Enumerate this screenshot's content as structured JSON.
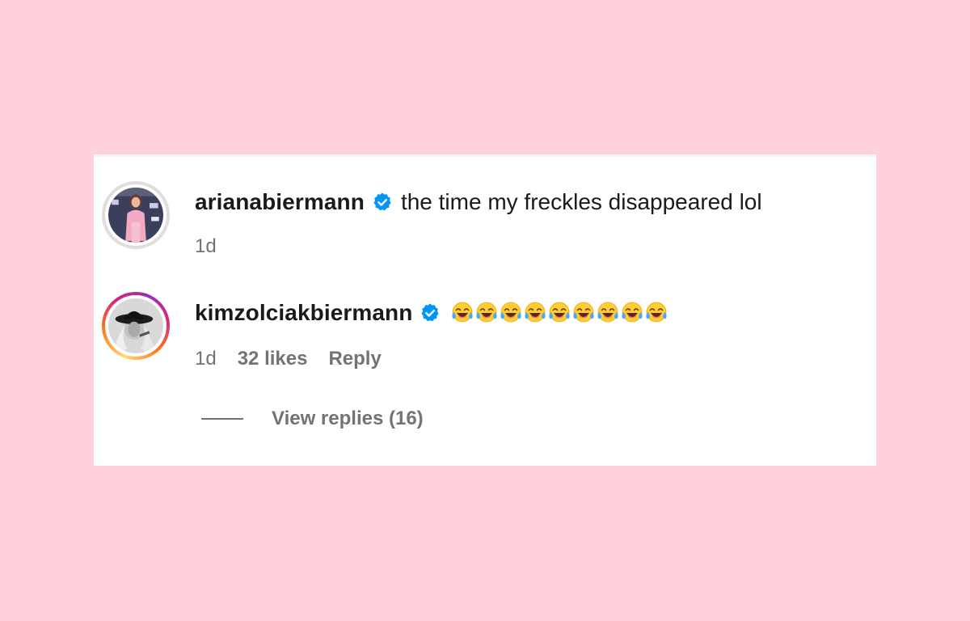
{
  "comments": [
    {
      "username": "arianabiermann",
      "text": "the time my freckles disappeared lol",
      "time": "1d"
    },
    {
      "username": "kimzolciakbiermann",
      "emoji_icon": "face-with-tears-of-joy-icon",
      "emoji_count": 9,
      "time": "1d",
      "likes": "32 likes",
      "reply_label": "Reply"
    }
  ],
  "view_replies": {
    "label": "View replies (16)"
  },
  "colors": {
    "background": "#ffd1dc",
    "panel": "#ffffff",
    "text": "#1a1a1a",
    "meta_text": "#737373",
    "verified_blue": "#0095f6"
  }
}
